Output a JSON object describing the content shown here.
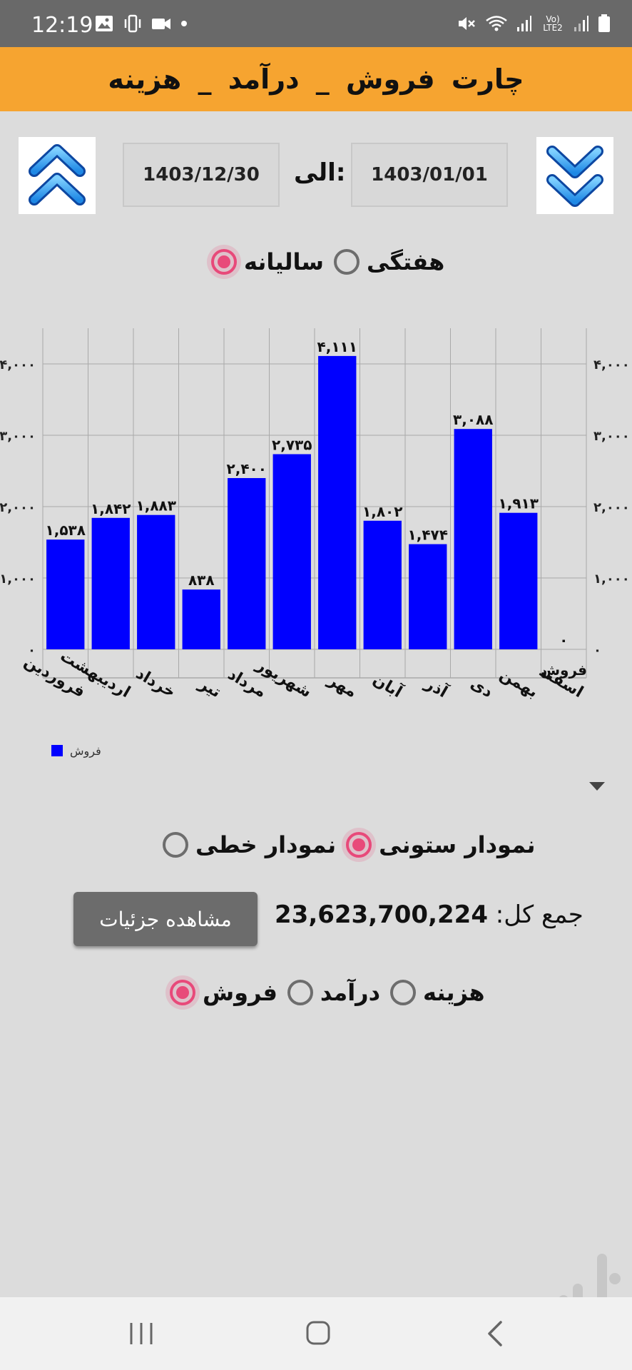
{
  "status_bar": {
    "time": "12:19",
    "left_icons": [
      "image-icon",
      "vibrate-icon",
      "video-icon",
      "dot-icon"
    ],
    "right_icons": [
      "mute-icon",
      "wifi-icon",
      "signal-icon",
      "volte-icon",
      "signal-icon",
      "battery-icon"
    ],
    "volte_text": "Vo) LTE2"
  },
  "header": {
    "title": "چارت  فروش  _  درآمد  _  هزینه"
  },
  "date_range": {
    "from": "1403/01/01",
    "to": "1403/12/30",
    "to_label": "الی:"
  },
  "period_options": [
    {
      "label": "هفتگی",
      "selected": false
    },
    {
      "label": "سالیانه",
      "selected": true
    }
  ],
  "chart_data": {
    "type": "bar",
    "categories": [
      "فروردین",
      "اردیبهشت",
      "خرداد",
      "تیر",
      "مرداد",
      "شهریور",
      "مهر",
      "آبان",
      "آذر",
      "دی",
      "بهمن",
      "اسفند"
    ],
    "series": [
      {
        "name": "فروش",
        "values": [
          1538,
          1842,
          1883,
          838,
          2400,
          2735,
          4111,
          1802,
          1474,
          3088,
          1913,
          0
        ],
        "color": "#0000ff"
      }
    ],
    "value_labels": [
      "۱,۵۳۸",
      "۱,۸۴۲",
      "۱,۸۸۳",
      "۸۳۸",
      "۲,۴۰۰",
      "۲,۷۳۵",
      "۴,۱۱۱",
      "۱,۸۰۲",
      "۱,۴۷۴",
      "۳,۰۸۸",
      "۱,۹۱۳",
      "۰"
    ],
    "y_ticks": [
      0,
      1000,
      2000,
      3000,
      4000
    ],
    "y_tick_labels": [
      "۰",
      "۱,۰۰۰",
      "۲,۰۰۰",
      "۳,۰۰۰",
      "۴,۰۰۰"
    ],
    "ylim": [
      -400,
      4500
    ],
    "grid": true,
    "legend": "bottom-left",
    "series_label_at_end": "فروش"
  },
  "chart_type_options": [
    {
      "label": "نمودار خطی",
      "selected": false
    },
    {
      "label": "نمودار ستونی",
      "selected": true
    }
  ],
  "summary": {
    "label": "جمع کل:",
    "value": "23,623,700,224",
    "details_button": "مشاهده جزئیات"
  },
  "data_type_options": [
    {
      "label": "هزینه",
      "selected": false
    },
    {
      "label": "درآمد",
      "selected": false
    },
    {
      "label": "فروش",
      "selected": true
    }
  ],
  "nav_bar": {
    "icons": [
      "recent-apps-icon",
      "home-icon",
      "back-icon"
    ]
  },
  "watermark": "bazaar-logo"
}
